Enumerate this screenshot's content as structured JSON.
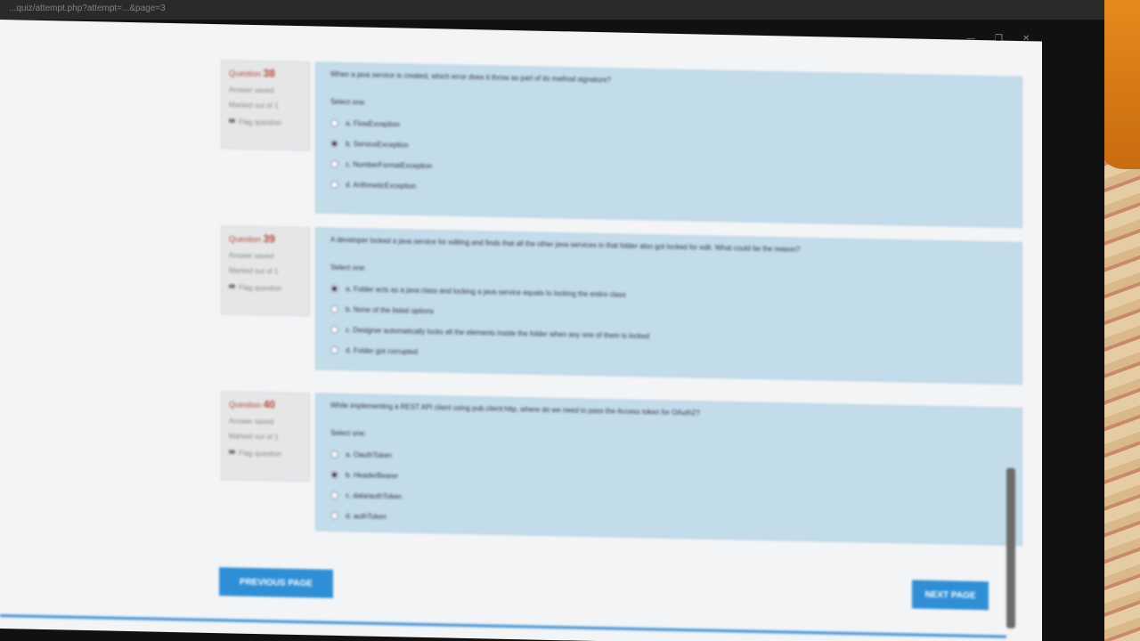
{
  "browser": {
    "url": "...quiz/attempt.php?attempt=...&page=3",
    "controls": [
      "—",
      "❐",
      "✕"
    ]
  },
  "questions": [
    {
      "label": "Question",
      "number": "38",
      "status": "Answer saved",
      "mark": "Marked out of 1",
      "flag": "Flag question",
      "text": "When a java service is created, which error does it throw as part of its method signature?",
      "select_label": "Select one:",
      "options": [
        {
          "label": "a. FlowException",
          "checked": false
        },
        {
          "label": "b. ServiceException",
          "checked": true
        },
        {
          "label": "c. NumberFormatException",
          "checked": false
        },
        {
          "label": "d. ArithmeticException",
          "checked": false
        }
      ]
    },
    {
      "label": "Question",
      "number": "39",
      "status": "Answer saved",
      "mark": "Marked out of 1",
      "flag": "Flag question",
      "text": "A developer locked a java service for editing and finds that all the other java services in that folder also got locked for edit. What could be the reason?",
      "select_label": "Select one:",
      "options": [
        {
          "label": "a. Folder acts as a java class and locking a java service equals to locking the entire class",
          "checked": true
        },
        {
          "label": "b. None of the listed options",
          "checked": false
        },
        {
          "label": "c. Designer automatically locks all the elements inside the folder when any one of them is locked",
          "checked": false
        },
        {
          "label": "d. Folder got corrupted",
          "checked": false
        }
      ]
    },
    {
      "label": "Question",
      "number": "40",
      "status": "Answer saved",
      "mark": "Marked out of 1",
      "flag": "Flag question",
      "text": "While implementing a REST API client using pub.client:http, where do we need to pass the Access token for OAuth2?",
      "select_label": "Select one:",
      "options": [
        {
          "label": "a. OauthToken",
          "checked": false
        },
        {
          "label": "b. HeaderBearer",
          "checked": true
        },
        {
          "label": "c. data/authToken",
          "checked": false
        },
        {
          "label": "d. authToken",
          "checked": false
        }
      ]
    }
  ],
  "nav": {
    "previous_label": "PREVIOUS PAGE",
    "next_label": "NEXT PAGE"
  }
}
